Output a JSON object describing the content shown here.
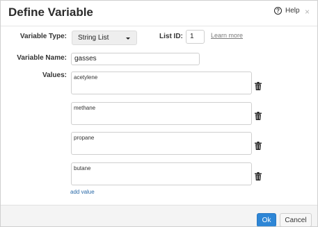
{
  "dialog": {
    "title": "Define Variable",
    "help_label": "Help",
    "close_glyph": "×"
  },
  "form": {
    "variable_type_label": "Variable Type:",
    "variable_type_value": "String List",
    "list_id_label": "List ID:",
    "list_id_value": "1",
    "learn_more_label": "Learn more",
    "variable_name_label": "Variable Name:",
    "variable_name_value": "gasses",
    "values_label": "Values:",
    "values": [
      "acetylene",
      "methane",
      "propane",
      "butane"
    ],
    "add_value_label": "add value"
  },
  "footer": {
    "ok_label": "Ok",
    "cancel_label": "Cancel"
  },
  "icons": {
    "help": "question-circle-icon",
    "close": "close-icon",
    "dropdown": "caret-down-icon",
    "delete": "trash-icon"
  },
  "colors": {
    "primary_button": "#2e86d6",
    "link": "#2a6aa8",
    "footer_bg": "#f4f4f4"
  }
}
